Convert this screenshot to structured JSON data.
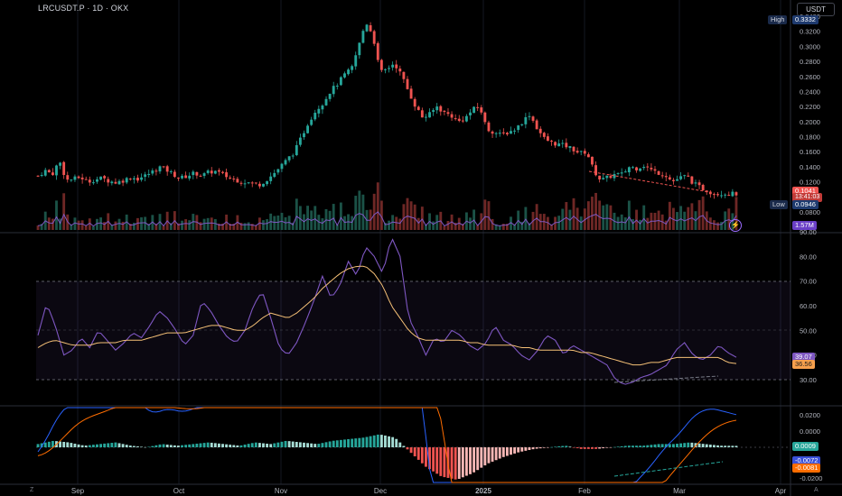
{
  "header": {
    "symbol": "LRCUSDT.P · 1D · OKX",
    "currency": "USDT"
  },
  "price_axis": {
    "ticks": [
      "0.3400",
      "0.3200",
      "0.3000",
      "0.2800",
      "0.2600",
      "0.2400",
      "0.2200",
      "0.2000",
      "0.1800",
      "0.1600",
      "0.1400",
      "0.1200",
      "0.0800"
    ],
    "high_label": "High",
    "high_value": "0.3332",
    "current_price": "0.1041",
    "countdown": "13:41:03",
    "low_label": "Low",
    "low_value": "0.0946",
    "volume_value": "1.57M"
  },
  "rsi_axis": {
    "ticks": [
      "90.00",
      "80.00",
      "70.00",
      "60.00",
      "50.00",
      "40.00",
      "30.00"
    ],
    "rsi_value": "39.07",
    "rsi_ma_value": "36.56"
  },
  "macd_axis": {
    "ticks": [
      "0.0200",
      "0.0000",
      "-0.0200"
    ],
    "hist_value": "0.0009",
    "macd_value": "-0.0072",
    "signal_value": "-0.0081"
  },
  "time_axis": {
    "months": [
      "Sep",
      "Oct",
      "Nov",
      "Dec",
      "2025",
      "Feb",
      "Mar",
      "Apr"
    ]
  },
  "colors": {
    "up": "#26a69a",
    "down": "#ef5350",
    "rsi": "#7e57c2",
    "rsi_ma": "#f6c177",
    "macd": "#2962ff",
    "signal": "#ff6d00",
    "background": "#000000"
  },
  "chart_data": {
    "type": "candlestick",
    "price_path": [
      0.128,
      0.135,
      0.13,
      0.148,
      0.122,
      0.124,
      0.126,
      0.12,
      0.123,
      0.125,
      0.121,
      0.119,
      0.122,
      0.126,
      0.124,
      0.128,
      0.133,
      0.14,
      0.136,
      0.13,
      0.125,
      0.128,
      0.132,
      0.128,
      0.133,
      0.134,
      0.129,
      0.125,
      0.122,
      0.12,
      0.118,
      0.116,
      0.122,
      0.13,
      0.14,
      0.15,
      0.16,
      0.18,
      0.2,
      0.215,
      0.225,
      0.24,
      0.25,
      0.262,
      0.27,
      0.3,
      0.333,
      0.315,
      0.265,
      0.27,
      0.278,
      0.262,
      0.24,
      0.22,
      0.205,
      0.21,
      0.22,
      0.212,
      0.208,
      0.2,
      0.205,
      0.216,
      0.22,
      0.19,
      0.186,
      0.182,
      0.186,
      0.19,
      0.2,
      0.21,
      0.192,
      0.178,
      0.172,
      0.17,
      0.168,
      0.164,
      0.158,
      0.16,
      0.135,
      0.122,
      0.126,
      0.13,
      0.13,
      0.14,
      0.138,
      0.142,
      0.136,
      0.132,
      0.13,
      0.12,
      0.125,
      0.128,
      0.118,
      0.112,
      0.108,
      0.104,
      0.105,
      0.104,
      0.1041
    ],
    "rsi": [
      48,
      61,
      52,
      40,
      42,
      47,
      43,
      50,
      46,
      42,
      45,
      49,
      47,
      52,
      58,
      55,
      50,
      44,
      48,
      62,
      58,
      52,
      47,
      45,
      50,
      60,
      66,
      55,
      43,
      40,
      45,
      53,
      62,
      72,
      63,
      68,
      78,
      72,
      84,
      80,
      73,
      88,
      80,
      55,
      48,
      40,
      47,
      45,
      50,
      48,
      44,
      42,
      45,
      52,
      46,
      44,
      40,
      38,
      42,
      48,
      46,
      40,
      44,
      42,
      40,
      38,
      36,
      30,
      28,
      29,
      31,
      32,
      34,
      36,
      42,
      45,
      40,
      38,
      40,
      44,
      41,
      39.07
    ],
    "rsi_ma": [
      43,
      45,
      46,
      45,
      44,
      44,
      44,
      45,
      45,
      45,
      46,
      46,
      46,
      47,
      48,
      49,
      49,
      49,
      50,
      51,
      52,
      52,
      51,
      50,
      50,
      52,
      55,
      57,
      56,
      55,
      57,
      60,
      63,
      67,
      70,
      73,
      75,
      76,
      76,
      73,
      68,
      60,
      55,
      50,
      47,
      46,
      46,
      46,
      46,
      46,
      45,
      45,
      44,
      44,
      44,
      44,
      43,
      43,
      42,
      42,
      42,
      42,
      42,
      41,
      41,
      40,
      39,
      38,
      37,
      36,
      36,
      37,
      37,
      38,
      39,
      39,
      39,
      39,
      39,
      39,
      37,
      36.56
    ],
    "macd_hist": [
      0.002,
      0.004,
      0.003,
      0.001,
      0.002,
      0.003,
      0.001,
      0.0,
      0.002,
      0.001,
      0.002,
      0.003,
      0.002,
      0.001,
      0.003,
      0.002,
      0.004,
      0.003,
      0.002,
      0.004,
      0.005,
      0.006,
      0.008,
      0.006,
      -0.003,
      -0.012,
      -0.018,
      -0.02,
      -0.016,
      -0.01,
      -0.006,
      -0.003,
      -0.001,
      0.0,
      0.001,
      -0.001,
      -0.001,
      0.0,
      0.001,
      0.001,
      0.002,
      0.002,
      0.003,
      0.002,
      0.001,
      0.0009
    ],
    "price_axis_range": [
      0.08,
      0.34
    ],
    "rsi_axis_range": [
      30,
      90
    ],
    "rsi_bands": [
      30,
      50,
      70
    ]
  }
}
